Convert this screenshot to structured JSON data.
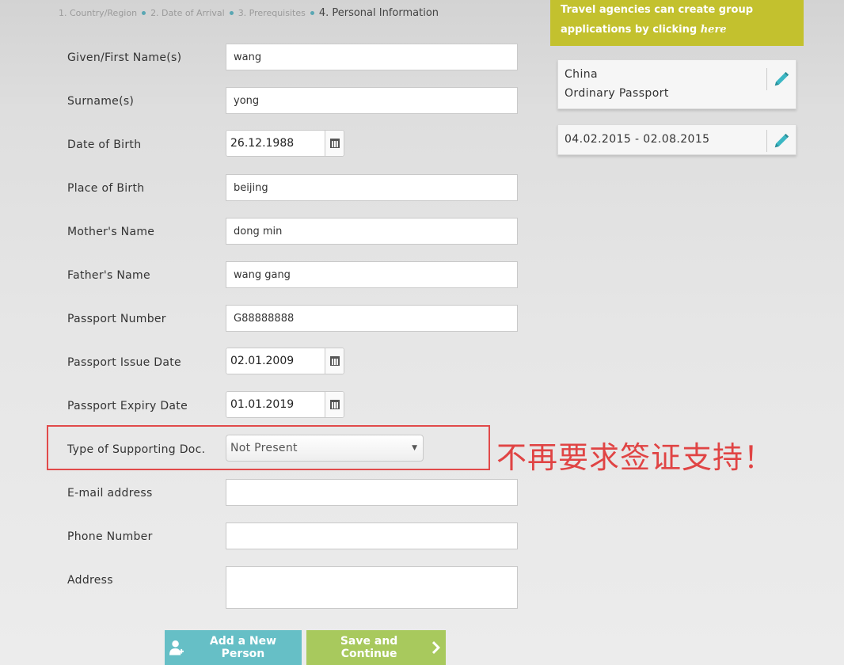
{
  "breadcrumb": [
    {
      "label": "1. Country/Region"
    },
    {
      "label": "2. Date of Arrival"
    },
    {
      "label": "3. Prerequisites"
    },
    {
      "label": "4. Personal Information"
    }
  ],
  "form": {
    "given_name": {
      "label": "Given/First Name(s)",
      "value": "wang"
    },
    "surname": {
      "label": "Surname(s)",
      "value": "yong"
    },
    "date_of_birth": {
      "label": "Date of Birth",
      "value": "26.12.1988"
    },
    "place_of_birth": {
      "label": "Place of Birth",
      "value": "beijing"
    },
    "mothers_name": {
      "label": "Mother's Name",
      "value": "dong min"
    },
    "fathers_name": {
      "label": "Father's Name",
      "value": "wang gang"
    },
    "passport_number": {
      "label": "Passport Number",
      "value": "G88888888"
    },
    "passport_issue_date": {
      "label": "Passport Issue Date",
      "value": "02.01.2009"
    },
    "passport_expiry_date": {
      "label": "Passport Expiry Date",
      "value": "01.01.2019"
    },
    "supporting_doc": {
      "label": "Type of Supporting Doc.",
      "value": "Not Present"
    },
    "email": {
      "label": "E-mail address",
      "value": ""
    },
    "phone": {
      "label": "Phone Number",
      "value": ""
    },
    "address": {
      "label": "Address",
      "value": ""
    }
  },
  "promo": {
    "text": "Travel agencies can create group applications by clicking",
    "link": "here"
  },
  "summary": {
    "country": "China",
    "passport_type": "Ordinary Passport",
    "dates": "04.02.2015 - 02.08.2015"
  },
  "annotation": "不再要求签证支持！",
  "buttons": {
    "add_person": "Add a New Person",
    "save_continue": "Save and Continue"
  },
  "colors": {
    "accent_teal": "#66bfc6",
    "accent_green": "#a8c95d",
    "promo_bg": "#c3c12e",
    "annotation_red": "#e04444"
  }
}
